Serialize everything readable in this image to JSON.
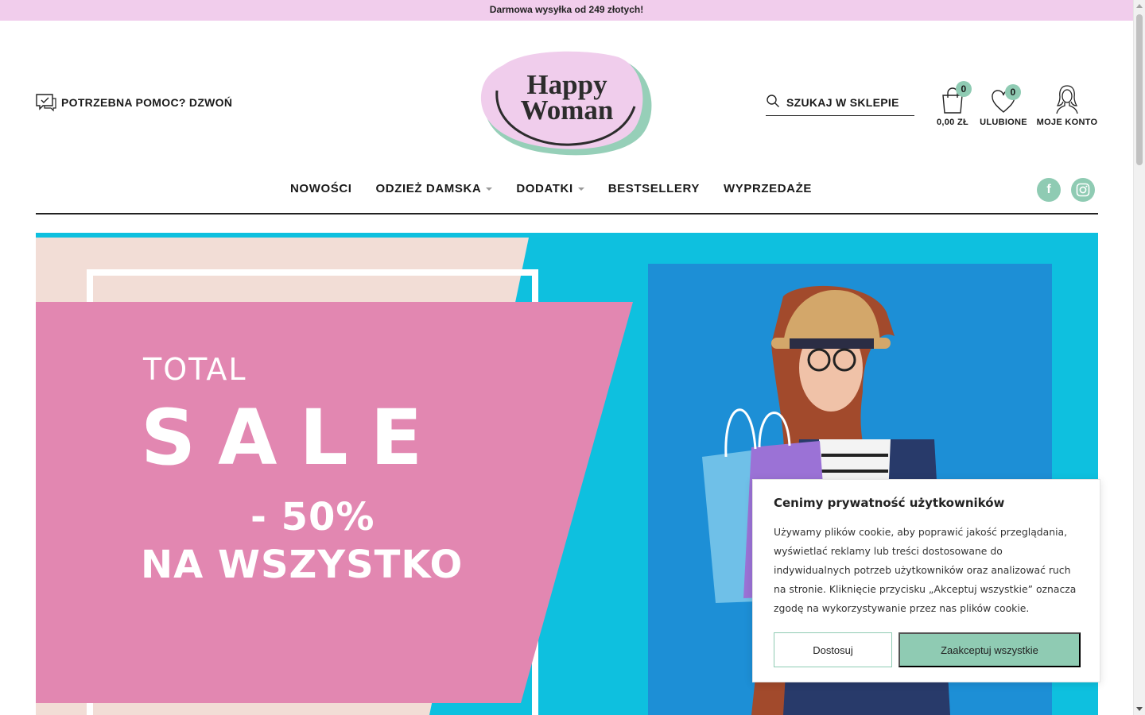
{
  "topbar": {
    "text": "Darmowa wysyłka od 249 złotych!"
  },
  "header": {
    "help_label": "POTRZEBNA POMOC? DZWOŃ",
    "logo_line1": "Happy",
    "logo_line2": "Woman",
    "search_label": "SZUKAJ W SKLEPIE",
    "cart": {
      "count": "0",
      "label": "0,00 ZŁ"
    },
    "favorites": {
      "count": "0",
      "label": "ULUBIONE"
    },
    "account": {
      "label": "MOJE KONTO"
    }
  },
  "nav": {
    "items": [
      {
        "label": "NOWOŚCI"
      },
      {
        "label": "ODZIEŻ DAMSKA"
      },
      {
        "label": "DODATKI"
      },
      {
        "label": "BESTSELLERY"
      },
      {
        "label": "WYPRZEDAŻE"
      }
    ],
    "social": {
      "facebook": "f",
      "instagram": "instagram"
    }
  },
  "hero": {
    "line1": "TOTAL",
    "line2": "SALE",
    "line3": "- 50%",
    "line4": "NA WSZYSTKO"
  },
  "cookie": {
    "title": "Cenimy prywatność użytkowników",
    "body": "Używamy plików cookie, aby poprawić jakość przeglądania, wyświetlać reklamy lub treści dostosowane do indywidualnych potrzeb użytkowników oraz analizować ruch na stronie. Kliknięcie przycisku „Akceptuj wszystkie” oznacza zgodę na wykorzystywanie przez nas plików cookie.",
    "adjust_label": "Dostosuj",
    "accept_label": "Zaakceptuj wszystkie"
  },
  "colors": {
    "topbar": "#f1cdec",
    "accent": "#8fcbb3",
    "hero_blue": "#0ec0df",
    "hero_pink": "#e287b1",
    "hero_peach": "#f2ddd6"
  }
}
